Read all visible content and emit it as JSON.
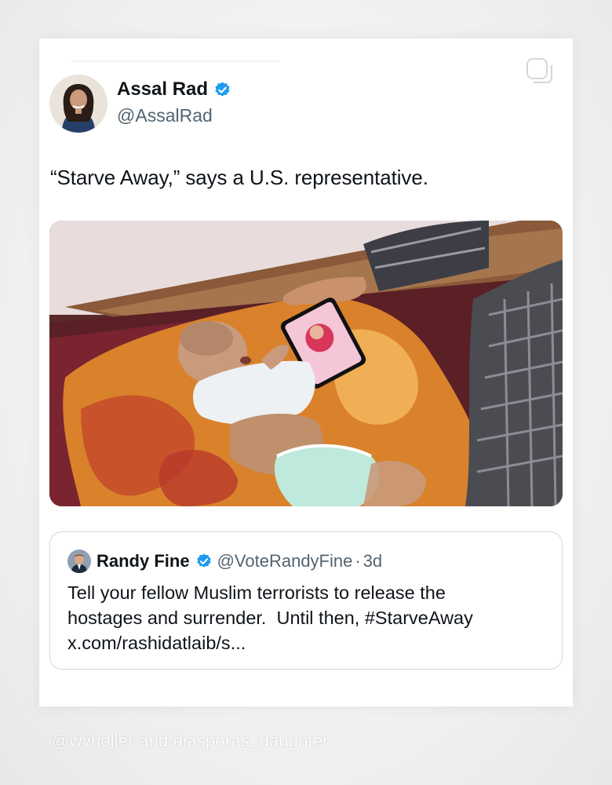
{
  "post": {
    "author": {
      "name": "Assal Rad",
      "handle": "@AssalRad",
      "verified": true
    },
    "text": "“Starve Away,” says a U.S. representative.",
    "media": {
      "kind": "photo"
    },
    "quoted_post": {
      "author": {
        "name": "Randy Fine",
        "handle": "@VoteRandyFine",
        "verified": true
      },
      "separator": "·",
      "time": "3d",
      "lines": [
        "Tell your fellow Muslim terrorists to release the",
        "hostages and surrender.  Until then, #StarveAway",
        "x.com/rashidatlaib/s..."
      ]
    }
  },
  "watermark": "@wvholler and diasporas_daughter",
  "colors": {
    "verified_blue": "#1d9bf0",
    "text_primary": "#0f1419",
    "text_secondary": "#536471",
    "border": "#cfd9de"
  },
  "icons": {
    "copy": "copy-icon",
    "verified": "verified-badge-icon"
  }
}
